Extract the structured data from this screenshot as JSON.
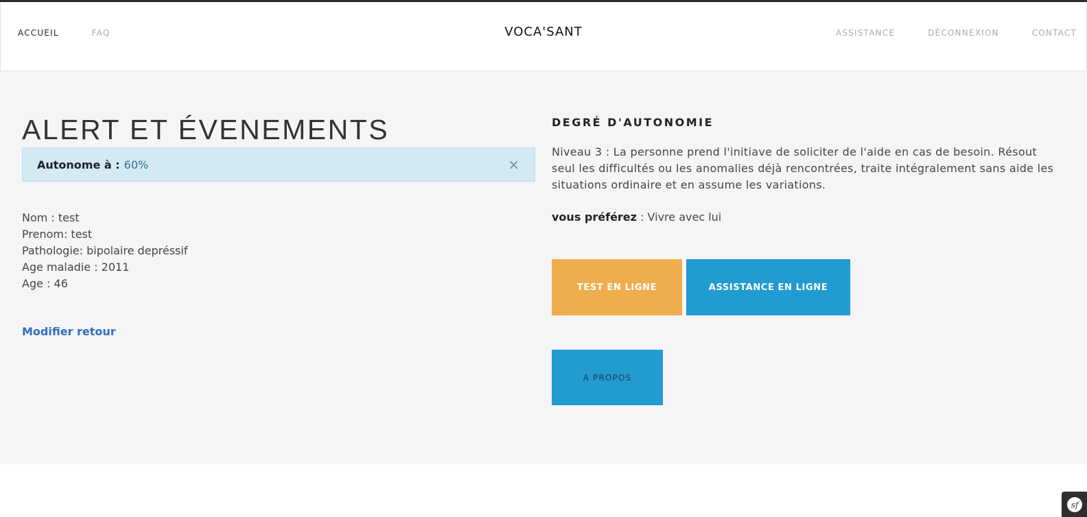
{
  "nav": {
    "left": [
      {
        "label": "ACCUEIL"
      },
      {
        "label": "FAQ"
      }
    ],
    "brand": "VOCA'SANT",
    "right": [
      {
        "label": "ASSISTANCE"
      },
      {
        "label": "DÉCONNEXION"
      },
      {
        "label": "CONTACT"
      }
    ]
  },
  "left": {
    "title": "ALERT ET ÉVENEMENTS",
    "alert": {
      "label": "Autonome à :",
      "value": "60%",
      "close": "×"
    },
    "info": [
      "Nom : test",
      "Prenom: test",
      "Pathologie: bipolaire depréssif",
      "Age maladie : 2011",
      "Age : 46"
    ],
    "modify_link": "Modifier retour"
  },
  "right": {
    "section_title": "DEGRÉ D'AUTONOMIE",
    "level_text": "Niveau 3 : La personne prend l'initiave de soliciter de l'aide en cas de besoin. Résout seul les difficultés ou les anomalies déjà rencontrées, traite intégralement sans aide les situations ordinaire et en assume les variations.",
    "preference": {
      "label": "vous préférez",
      "value": " : Vivre avec lui"
    },
    "buttons": {
      "test": "TEST EN LIGNE",
      "assistance": "ASSISTANCE EN LIGNE",
      "about": "A PROPOS"
    }
  },
  "colors": {
    "accent_orange": "#efad4e",
    "accent_blue": "#229bd1",
    "alert_bg": "#d3e9f3",
    "link_blue": "#2f6fbe",
    "main_bg": "#f5f5f7"
  },
  "icons": {
    "debug_toolbar": "symfony-icon"
  }
}
